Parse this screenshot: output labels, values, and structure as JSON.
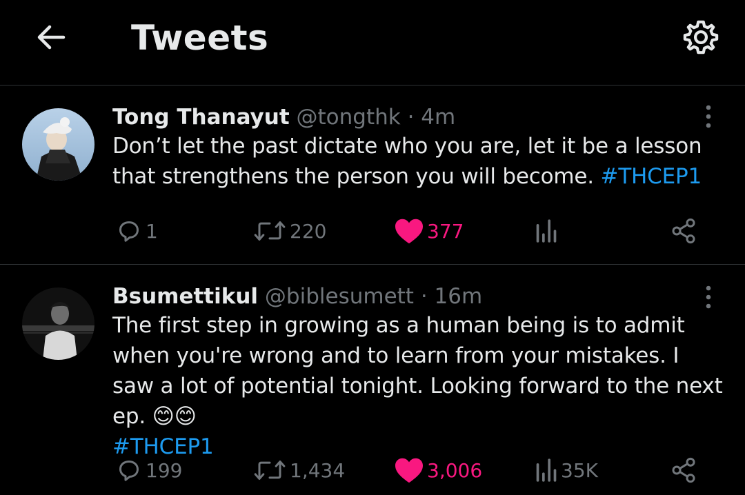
{
  "header": {
    "title": "Tweets",
    "back_icon": "back-arrow-icon",
    "settings_icon": "gear-icon"
  },
  "colors": {
    "background": "#000000",
    "text": "#e7e9ea",
    "muted": "#71767b",
    "hashtag": "#1d9bf0",
    "like": "#f91880",
    "divider": "#2f3336"
  },
  "tweets": [
    {
      "display_name": "Tong Thanayut",
      "handle": "@tongthk",
      "separator": "·",
      "time": "4m",
      "text": "Don’t let the past dictate who you are, let it be a lesson that strengthens the person you will become.",
      "hashtag": "#THCEP1",
      "replies": "1",
      "retweets": "220",
      "likes": "377",
      "views": "",
      "liked": true
    },
    {
      "display_name": "Bsumettikul",
      "handle": "@biblesumett",
      "separator": "·",
      "time": "16m",
      "text": "The first step in growing as a human being is to admit when you're wrong and to learn from your mistakes. I saw a lot of potential tonight. Looking forward to the next ep. 😊😊",
      "hashtag": "#THCEP1",
      "replies": "199",
      "retweets": "1,434",
      "likes": "3,006",
      "views": "35K",
      "liked": true
    }
  ]
}
